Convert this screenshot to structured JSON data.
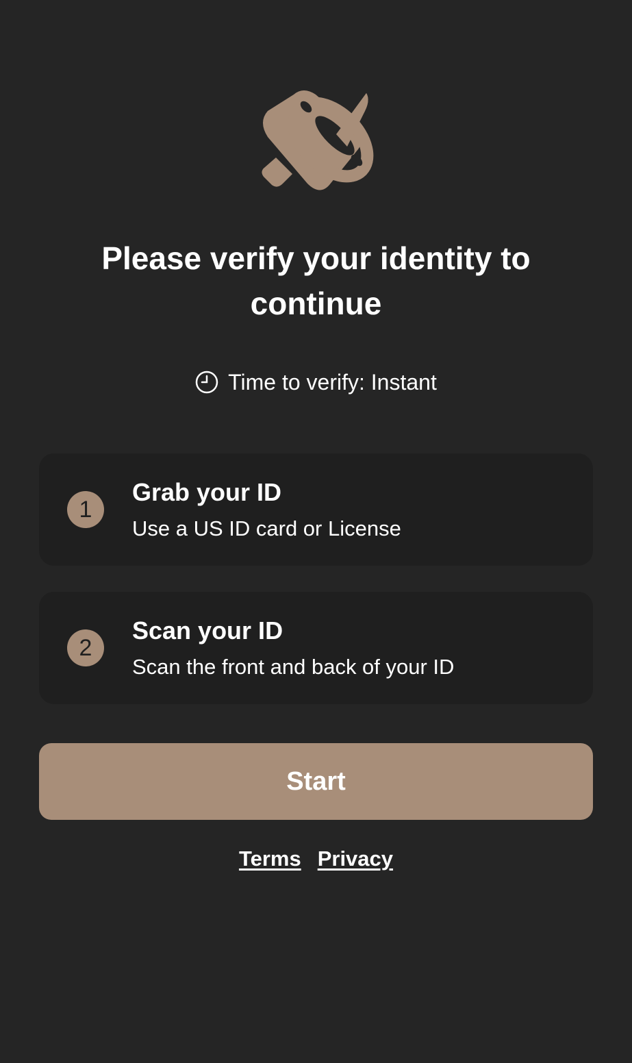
{
  "logo": {
    "icon": "orbit-emblem-icon",
    "color": "#a88e79"
  },
  "heading": "Please verify your identity to continue",
  "time_to_verify": {
    "icon": "clock-icon",
    "text": "Time to verify: Instant"
  },
  "steps": [
    {
      "number": "1",
      "title": "Grab your ID",
      "description": "Use a US ID card or License"
    },
    {
      "number": "2",
      "title": "Scan your ID",
      "description": "Scan the front and back of your ID"
    }
  ],
  "start_button": {
    "label": "Start"
  },
  "footer_links": {
    "terms": "Terms",
    "privacy": "Privacy"
  },
  "colors": {
    "background": "#252525",
    "card": "#1f1f1f",
    "accent": "#a88e79",
    "text": "#ffffff"
  }
}
